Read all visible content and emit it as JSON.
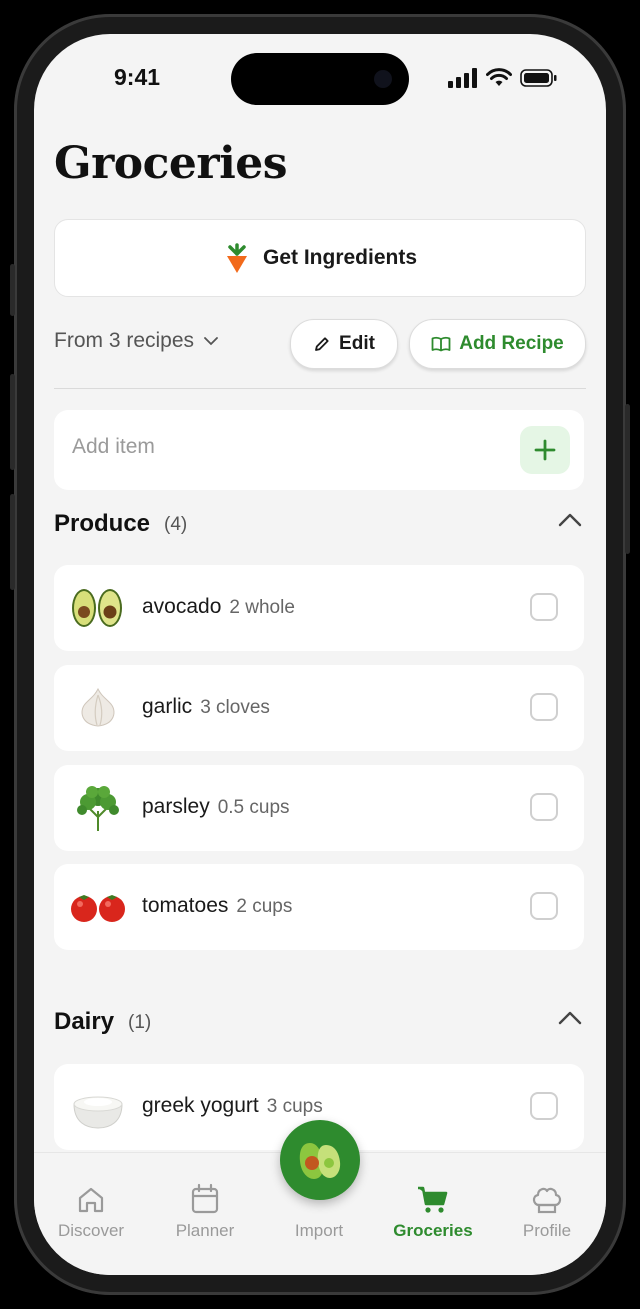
{
  "status_bar": {
    "time": "9:41"
  },
  "page": {
    "title": "Groceries"
  },
  "actions": {
    "get_ingredients": "Get Ingredients",
    "from_recipes": "From 3 recipes",
    "edit": "Edit",
    "add_recipe": "Add Recipe"
  },
  "add_item": {
    "placeholder": "Add item"
  },
  "sections": [
    {
      "name": "Produce",
      "count": "(4)",
      "items": [
        {
          "name": "avocado",
          "qty": "2 whole",
          "icon": "avocado-icon",
          "checked": false
        },
        {
          "name": "garlic",
          "qty": "3 cloves",
          "icon": "garlic-icon",
          "checked": false
        },
        {
          "name": "parsley",
          "qty": "0.5 cups",
          "icon": "parsley-icon",
          "checked": false
        },
        {
          "name": "tomatoes",
          "qty": "2 cups",
          "icon": "tomato-icon",
          "checked": false
        }
      ]
    },
    {
      "name": "Dairy",
      "count": "(1)",
      "items": [
        {
          "name": "greek yogurt",
          "qty": "3 cups",
          "icon": "yogurt-icon",
          "checked": false
        }
      ]
    }
  ],
  "tabs": [
    {
      "label": "Discover",
      "icon": "home-icon",
      "active": false
    },
    {
      "label": "Planner",
      "icon": "calendar-icon",
      "active": false
    },
    {
      "label": "Import",
      "icon": "avocado-fab-icon",
      "active": false
    },
    {
      "label": "Groceries",
      "icon": "cart-icon",
      "active": true
    },
    {
      "label": "Profile",
      "icon": "chef-hat-icon",
      "active": false
    }
  ],
  "colors": {
    "accent": "#2e8b2e",
    "accent_light": "#e5f6e5",
    "background": "#f4f4f4"
  }
}
